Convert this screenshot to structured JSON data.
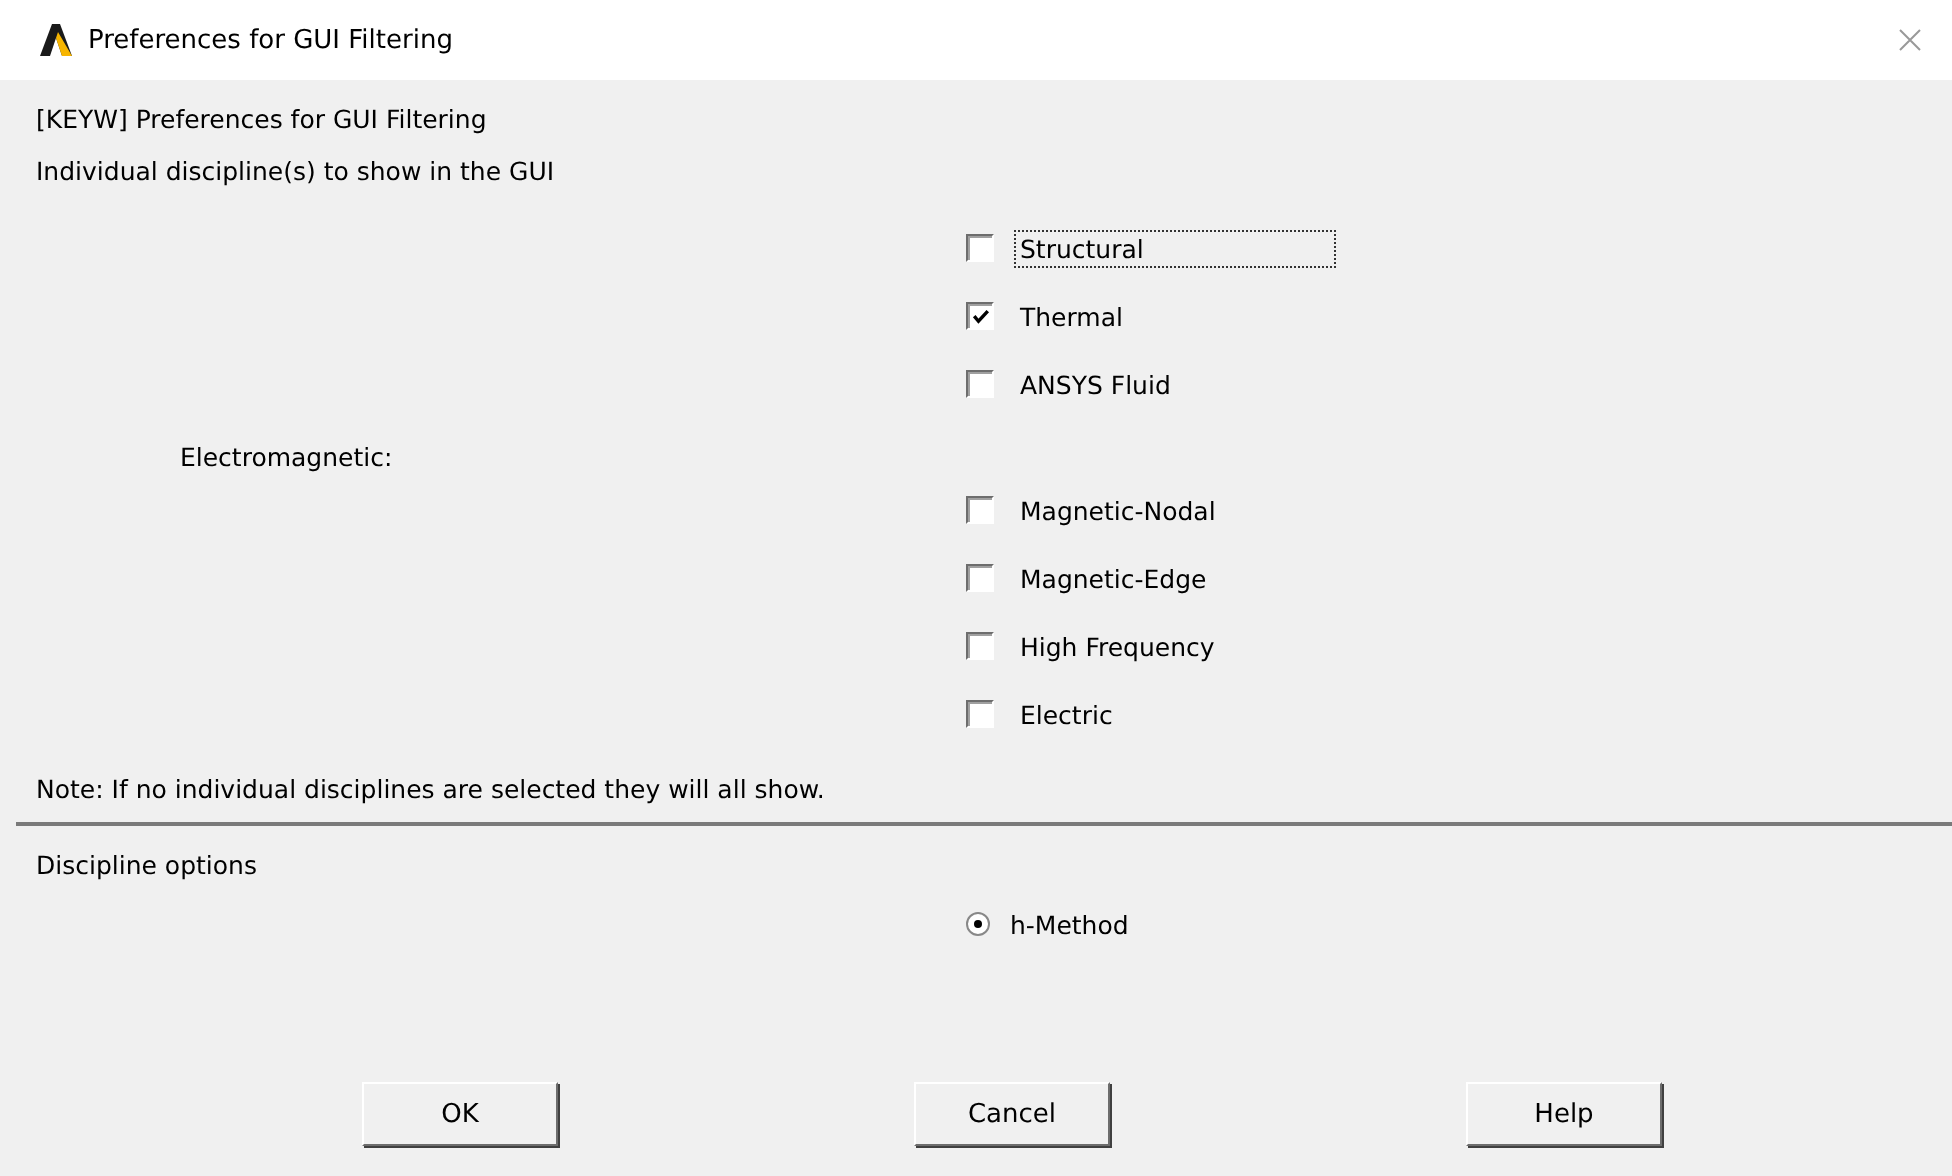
{
  "window": {
    "title": "Preferences for GUI Filtering"
  },
  "heading": "[KEYW] Preferences for GUI Filtering",
  "disciplines_label": "Individual discipline(s) to show in the GUI",
  "disciplines": [
    {
      "kind": "checkbox",
      "label": "Structural",
      "checked": false,
      "focused": true
    },
    {
      "kind": "checkbox",
      "label": "Thermal",
      "checked": true,
      "focused": false
    },
    {
      "kind": "checkbox",
      "label": "ANSYS Fluid",
      "checked": false,
      "focused": false
    },
    {
      "kind": "group_label",
      "label": "Electromagnetic:"
    },
    {
      "kind": "checkbox",
      "label": "Magnetic-Nodal",
      "checked": false,
      "focused": false
    },
    {
      "kind": "checkbox",
      "label": "Magnetic-Edge",
      "checked": false,
      "focused": false
    },
    {
      "kind": "checkbox",
      "label": "High Frequency",
      "checked": false,
      "focused": false
    },
    {
      "kind": "checkbox",
      "label": "Electric",
      "checked": false,
      "focused": false
    }
  ],
  "note": "Note: If no individual disciplines are selected they will all show.",
  "options_label": "Discipline options",
  "options": [
    {
      "label": "h-Method",
      "selected": true
    }
  ],
  "buttons": [
    "OK",
    "Cancel",
    "Help"
  ]
}
